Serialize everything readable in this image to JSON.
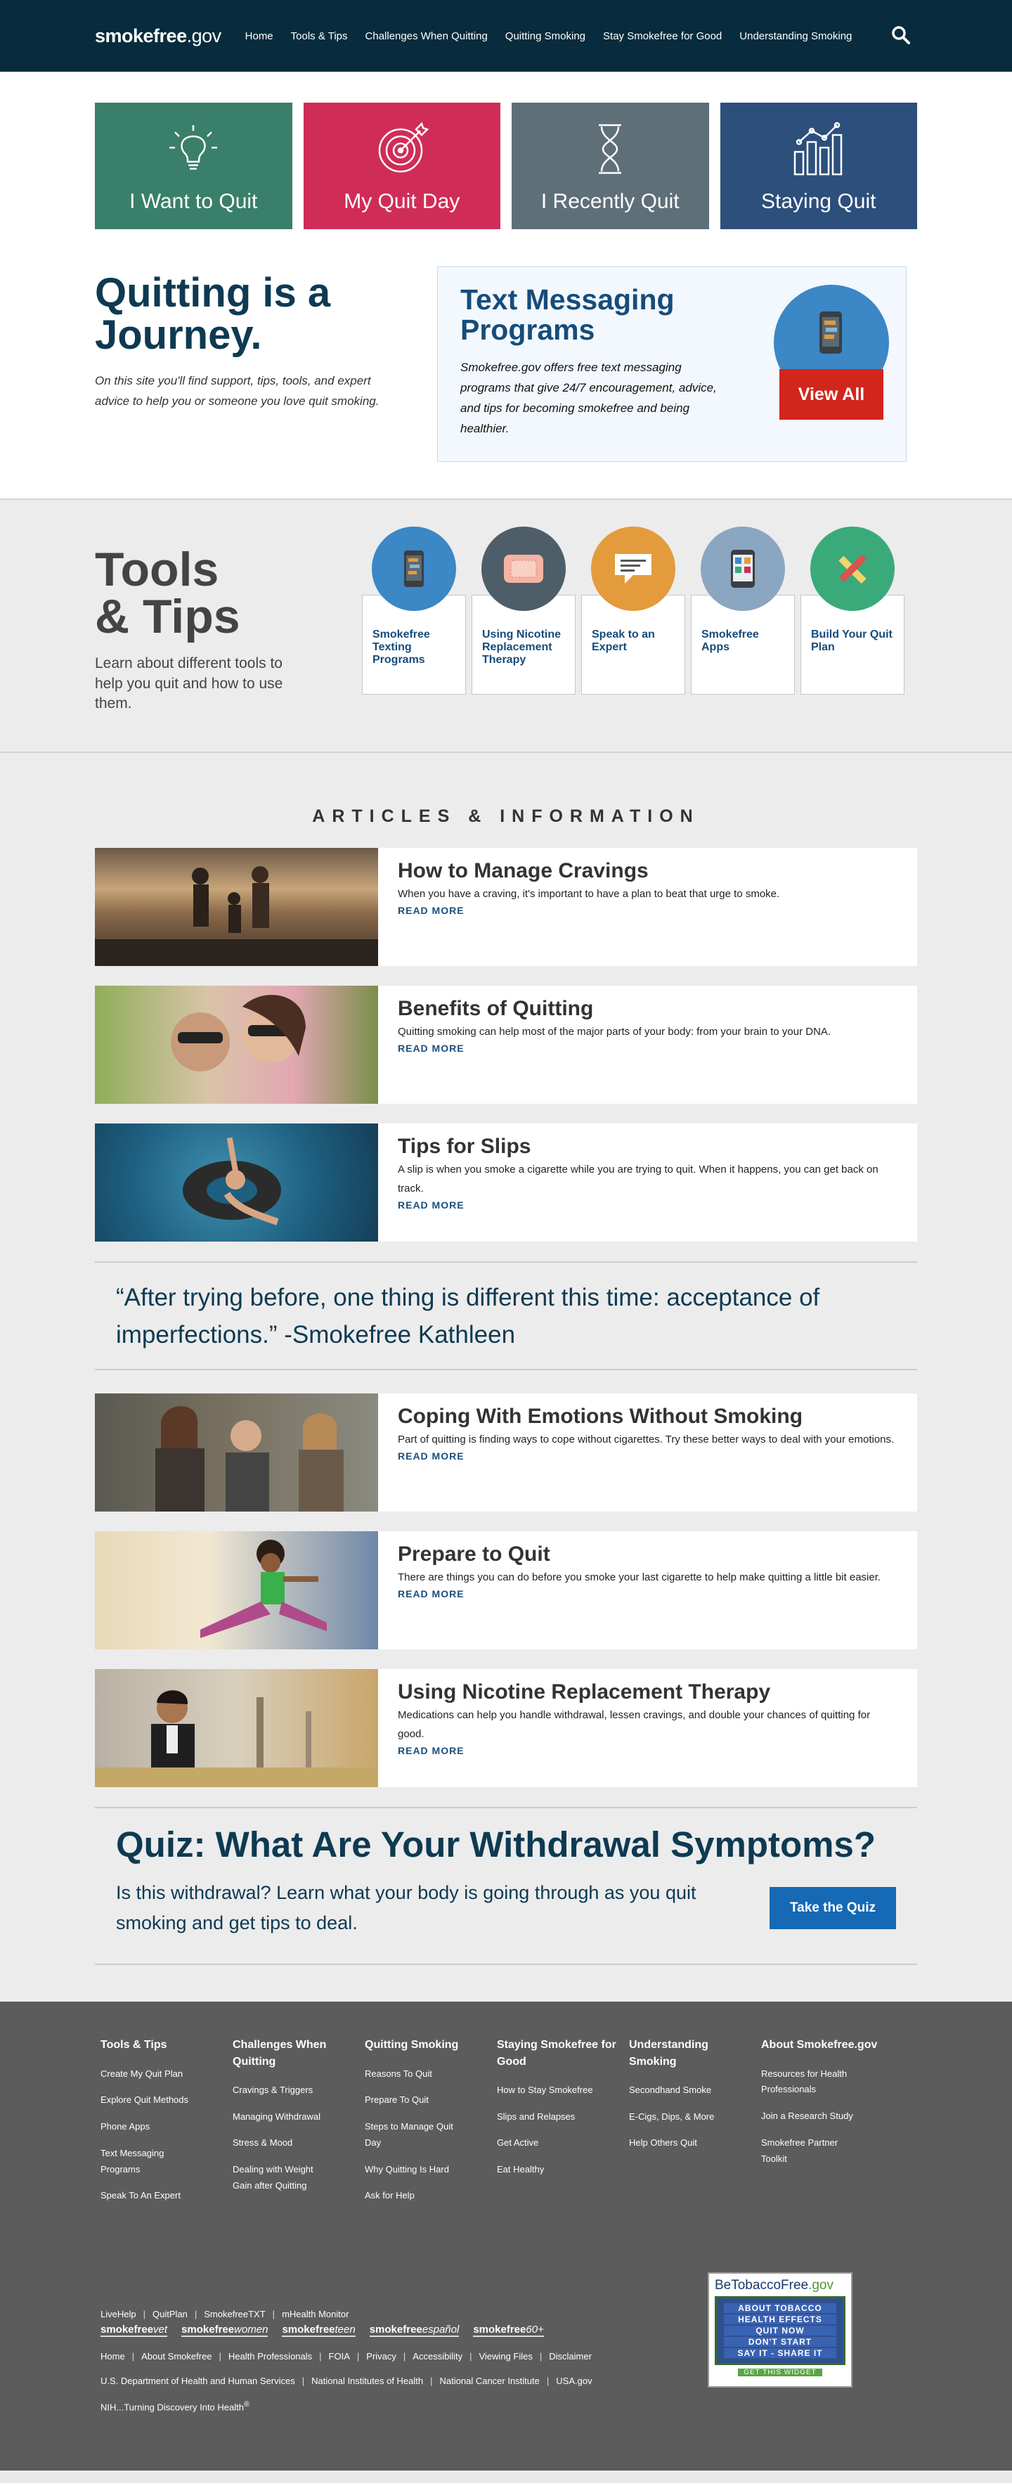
{
  "header": {
    "logo_bold": "smokefree",
    "logo_suffix": ".gov",
    "nav": [
      "Home",
      "Tools & Tips",
      "Challenges When Quitting",
      "Quitting Smoking",
      "Stay Smokefree for Good",
      "Understanding Smoking"
    ],
    "search_icon": "search-icon"
  },
  "tiles": [
    {
      "label": "I Want to Quit",
      "icon": "lightbulb-icon",
      "color": "#3a7f6a"
    },
    {
      "label": "My Quit Day",
      "icon": "target-icon",
      "color": "#cf2d58"
    },
    {
      "label": "I Recently Quit",
      "icon": "hourglass-icon",
      "color": "#5f6f78"
    },
    {
      "label": "Staying Quit",
      "icon": "bar-chart-icon",
      "color": "#2c4f7c"
    }
  ],
  "journey": {
    "title": "Quitting is a Journey.",
    "text": "On this site you'll find support, tips, tools, and expert advice to help you or someone you love quit smoking."
  },
  "text_programs": {
    "title": "Text Messaging Programs",
    "body": "Smokefree.gov offers free text messaging programs that give 24/7 encouragement, advice, and tips for becoming smokefree and being healthier.",
    "button": "View All"
  },
  "tools": {
    "title_line1": "Tools",
    "title_line2": "& Tips",
    "text": "Learn about different tools to help you quit and how to use them.",
    "cards": [
      {
        "label": "Smokefree Texting Programs",
        "color": "#3c87c5",
        "icon": "phone-icon"
      },
      {
        "label": "Using Nicotine Replacement Therapy",
        "color": "#4e5e68",
        "icon": "nicotine-patch-icon"
      },
      {
        "label": "Speak to an Expert",
        "color": "#e39b3c",
        "icon": "chat-bubble-icon"
      },
      {
        "label": "Smokefree Apps",
        "color": "#8aa6c1",
        "icon": "mobile-app-icon"
      },
      {
        "label": "Build Your Quit Plan",
        "color": "#3aaa7a",
        "icon": "pencil-ruler-icon"
      }
    ]
  },
  "articles": {
    "heading": "ARTICLES & INFORMATION",
    "read_more": "READ MORE",
    "items_top": [
      {
        "title": "How to Manage Cravings",
        "desc": "When you have a craving, it's important to have a plan to beat that urge to smoke."
      },
      {
        "title": "Benefits of Quitting",
        "desc": "Quitting smoking can help most of the major parts of your body: from your brain to your DNA."
      },
      {
        "title": "Tips for Slips",
        "desc": "A slip is when you smoke a cigarette while you are trying to quit. When it happens, you can get back on track."
      }
    ],
    "quote": "“After trying before, one thing is different this time: acceptance of imperfections.” -Smokefree Kathleen",
    "items_bottom": [
      {
        "title": "Coping With Emotions Without Smoking",
        "desc": "Part of quitting is finding ways to cope without cigarettes. Try these better ways to deal with your emotions."
      },
      {
        "title": "Prepare to Quit",
        "desc": "There are things you can do before you smoke your last cigarette to help make quitting a little bit easier."
      },
      {
        "title": "Using Nicotine Replacement Therapy",
        "desc": "Medications can help you handle withdrawal, lessen cravings, and double your chances of quitting for good."
      }
    ]
  },
  "quiz": {
    "title": "Quiz: What Are Your Withdrawal Symptoms?",
    "text": "Is this withdrawal? Learn what your body is going through as you quit smoking and get tips to deal.",
    "button": "Take the Quiz"
  },
  "footer": {
    "columns": [
      {
        "title": "Tools & Tips",
        "links": [
          "Create My Quit Plan",
          "Explore Quit Methods",
          "Phone Apps",
          "Text Messaging Programs",
          "Speak To An Expert"
        ]
      },
      {
        "title": "Challenges When Quitting",
        "links": [
          "Cravings & Triggers",
          "Managing Withdrawal",
          "Stress & Mood",
          "Dealing with Weight Gain after Quitting"
        ]
      },
      {
        "title": "Quitting Smoking",
        "links": [
          "Reasons To Quit",
          "Prepare To Quit",
          "Steps to Manage Quit Day",
          "Why Quitting Is Hard",
          "Ask for Help"
        ]
      },
      {
        "title": "Staying Smokefree for Good",
        "links": [
          "How to Stay Smokefree",
          "Slips and Relapses",
          "Get Active",
          "Eat Healthy"
        ]
      },
      {
        "title": "Understanding Smoking",
        "links": [
          "Secondhand Smoke",
          "E-Cigs, Dips, & More",
          "Help Others Quit"
        ]
      },
      {
        "title": "About Smokefree.gov",
        "links": [
          "Resources for Health Professionals",
          "Join a Research Study",
          "Smokefree Partner Toolkit"
        ]
      }
    ],
    "programs": [
      "LiveHelp",
      "QuitPlan",
      "SmokefreeTXT",
      "mHealth Monitor"
    ],
    "brands": [
      {
        "bold": "smokefree",
        "suffix": "vet"
      },
      {
        "bold": "smokefree",
        "suffix": "women"
      },
      {
        "bold": "smokefree",
        "suffix": "teen"
      },
      {
        "bold": "smokefree",
        "suffix": "español"
      },
      {
        "bold": "smokefree",
        "suffix": "60+"
      }
    ],
    "utility": [
      "Home",
      "About Smokefree",
      "Health Professionals",
      "FOIA",
      "Privacy",
      "Accessibility",
      "Viewing Files",
      "Disclaimer"
    ],
    "agencies": [
      "U.S. Department of Health and Human Services",
      "National Institutes of Health",
      "National Cancer Institute",
      "USA.gov"
    ],
    "nih": "NIH...Turning Discovery Into Health",
    "nih_mark": "®",
    "widget": {
      "title_main": "BeTobaccoFree",
      "title_suffix": ".gov",
      "lines": [
        "ABOUT TOBACCO",
        "HEALTH EFFECTS",
        "QUIT NOW",
        "DON'T START",
        "SAY IT - SHARE IT"
      ],
      "button": "GET THIS WIDGET"
    }
  }
}
